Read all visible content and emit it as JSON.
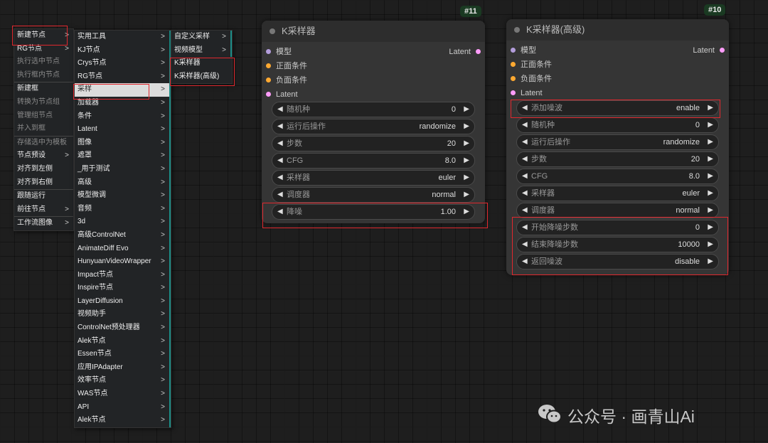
{
  "menu1": [
    {
      "label": "新建节点",
      "sub": true
    },
    {
      "label": "RG节点",
      "sub": true
    },
    {
      "label": "执行选中节点",
      "disabled": true
    },
    {
      "label": "执行框内节点",
      "disabled": true
    },
    {
      "label": "新建框"
    },
    {
      "label": "转换为节点组",
      "disabled": true
    },
    {
      "label": "管理组节点",
      "disabled": true
    },
    {
      "label": "并入到框",
      "disabled": true
    },
    {
      "label": "存储选中为模板",
      "disabled": true
    },
    {
      "label": "节点预设",
      "sub": true
    },
    {
      "label": "对齐到左侧"
    },
    {
      "label": "对齐到右侧"
    },
    {
      "label": "跟随运行"
    },
    {
      "label": "前往节点",
      "sub": true
    },
    {
      "label": "工作流图像",
      "sub": true
    }
  ],
  "menu2": [
    "实用工具",
    "KJ节点",
    "Crys节点",
    "RG节点",
    "采样",
    "加载器",
    "条件",
    "Latent",
    "图像",
    "遮罩",
    "_用于测试",
    "高级",
    "模型微调",
    "音频",
    "3d",
    "高级ControlNet",
    "AnimateDiff Evo",
    "HunyuanVideoWrapper",
    "Impact节点",
    "Inspire节点",
    "LayerDiffusion",
    "视频助手",
    "ControlNet预处理器",
    "Alek节点",
    "Essen节点",
    "应用IPAdapter",
    "效率节点",
    "WAS节点",
    "API",
    "Alek节点"
  ],
  "menu3": [
    "自定义采样",
    "视频模型",
    "K采样器",
    "K采样器(高级)"
  ],
  "node11": {
    "badge": "#11",
    "title": "K采样器",
    "inputs": [
      "模型",
      "正面条件",
      "负面条件",
      "Latent"
    ],
    "output": "Latent",
    "widgets": [
      {
        "label": "随机种",
        "value": "0"
      },
      {
        "label": "运行后操作",
        "value": "randomize"
      },
      {
        "label": "步数",
        "value": "20"
      },
      {
        "label": "CFG",
        "value": "8.0"
      },
      {
        "label": "采样器",
        "value": "euler"
      },
      {
        "label": "调度器",
        "value": "normal"
      },
      {
        "label": "降噪",
        "value": "1.00"
      }
    ]
  },
  "node10": {
    "badge": "#10",
    "title": "K采样器(高级)",
    "inputs": [
      "模型",
      "正面条件",
      "负面条件",
      "Latent"
    ],
    "output": "Latent",
    "widgets": [
      {
        "label": "添加噪波",
        "value": "enable"
      },
      {
        "label": "随机种",
        "value": "0"
      },
      {
        "label": "运行后操作",
        "value": "randomize"
      },
      {
        "label": "步数",
        "value": "20"
      },
      {
        "label": "CFG",
        "value": "8.0"
      },
      {
        "label": "采样器",
        "value": "euler"
      },
      {
        "label": "调度器",
        "value": "normal"
      },
      {
        "label": "开始降噪步数",
        "value": "0"
      },
      {
        "label": "结束降噪步数",
        "value": "10000"
      },
      {
        "label": "返回噪波",
        "value": "disable"
      }
    ]
  },
  "port_colors": {
    "model": "#b39ddb",
    "positive": "#ffa931",
    "negative": "#ffa931",
    "latent": "#ff9cf9"
  },
  "watermark": "公众号 · 画青山Ai",
  "icons": {
    "arrow_left": "◀",
    "arrow_right": "▶",
    "submenu": ">"
  }
}
